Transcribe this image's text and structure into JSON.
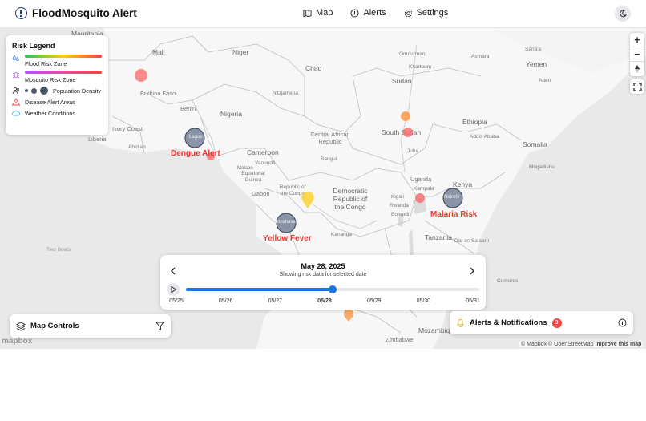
{
  "app": {
    "title": "FloodMosquito Alert"
  },
  "nav": {
    "map": "Map",
    "alerts": "Alerts",
    "settings": "Settings"
  },
  "legend": {
    "title": "Risk Legend",
    "flood": "Flood Risk Zone",
    "mosquito": "Mosquito Risk Zone",
    "population": "Population Density",
    "disease": "Disease Alert Areas",
    "weather": "Weather Conditions"
  },
  "zoom": {
    "in": "+",
    "out": "−"
  },
  "countries": {
    "mauritania": "Mauritania",
    "mali": "Mali",
    "niger": "Niger",
    "chad": "Chad",
    "sudan": "Sudan",
    "yemen": "Yemen",
    "burkina": "Burkina Faso",
    "benin": "Benin",
    "nigeria": "Nigeria",
    "ivory": "Ivory Coast",
    "liberia": "Liberia",
    "south_sudan": "South Sudan",
    "ethiopia": "Ethiopia",
    "car": "Central African Republic",
    "cameroon": "Cameroon",
    "somalia": "Somalia",
    "eq_guinea": "Equatorial Guinea",
    "gabon": "Gabon",
    "congo_rep": "Republic of the Congo",
    "drc": "Democratic Republic of the Congo",
    "uganda": "Uganda",
    "kenya": "Kenya",
    "rwanda": "Rwanda",
    "burundi": "Burundi",
    "tanzania": "Tanzania",
    "mozambique": "Mozambique",
    "zimbabwe": "Zimbabwe",
    "comoros": "Comoros"
  },
  "cities": {
    "khartoum": "Khartoum",
    "omdurman": "Omdurman",
    "asmara": "Asmara",
    "djamena": "N'Djamena",
    "sana": "Sana'a",
    "aden": "Aden",
    "abidjan": "Abidjan",
    "juba": "Juba",
    "addis": "Addis Ababa",
    "mogadishu": "Mogadishu",
    "bangui": "Bangui",
    "yaounde": "Yaoundé",
    "kampala": "Kampala",
    "kigali": "Kigali",
    "daressalaam": "Dar es Salaam",
    "kananga": "Kananga",
    "malabo": "Malabo",
    "lagos": "Lagos",
    "nairobi": "Nairobi",
    "kinshasa": "Kinshasa"
  },
  "seas": {
    "two_boats": "Two Boats"
  },
  "alerts_on_map": {
    "dengue": "Dengue Alert",
    "malaria": "Malaria Risk",
    "yellow": "Yellow Fever"
  },
  "timeline": {
    "date": "May 28, 2025",
    "subtitle": "Showing risk data for selected date",
    "progress_index": 3,
    "ticks": [
      "05/25",
      "05/26",
      "05/27",
      "05/28",
      "05/29",
      "05/30",
      "05/31"
    ]
  },
  "controls": {
    "map_controls": "Map Controls",
    "alerts_title": "Alerts & Notifications",
    "alert_count": "3"
  },
  "attribution": {
    "mapbox": "© Mapbox",
    "osm": "© OpenStreetMap",
    "improve": "Improve this map",
    "logo": "mapbox"
  },
  "colors": {
    "accent": "#1a73e8",
    "alert_red": "#ef4444",
    "dengue_text": "#e53935",
    "yellow_fever": "#facc15"
  }
}
